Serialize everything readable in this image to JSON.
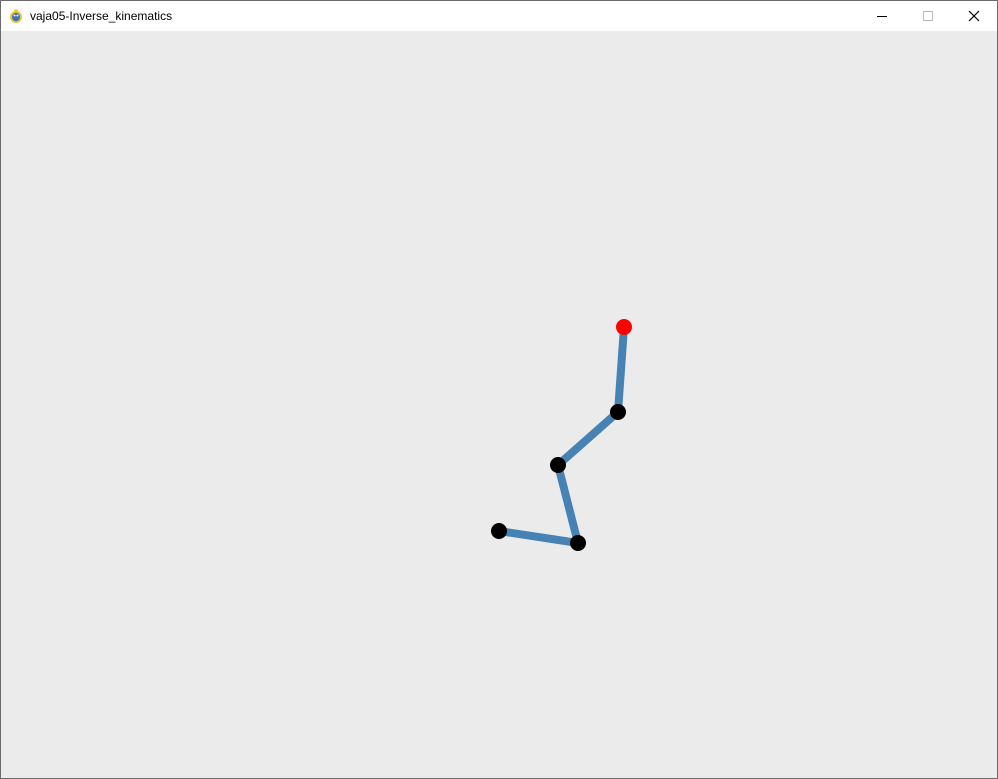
{
  "window": {
    "title": "vaja05-Inverse_kinematics",
    "app_icon": "pygame-snake-icon"
  },
  "controls": {
    "minimize_icon": "minimize-icon",
    "maximize_icon": "maximize-icon",
    "close_icon": "close-icon"
  },
  "colors": {
    "background": "#ebebeb",
    "segment": "#4682b4",
    "joint": "#000000",
    "end_effector": "#ff0000"
  },
  "arm": {
    "joint_count": 5,
    "end_effector": "red-target-joint"
  }
}
